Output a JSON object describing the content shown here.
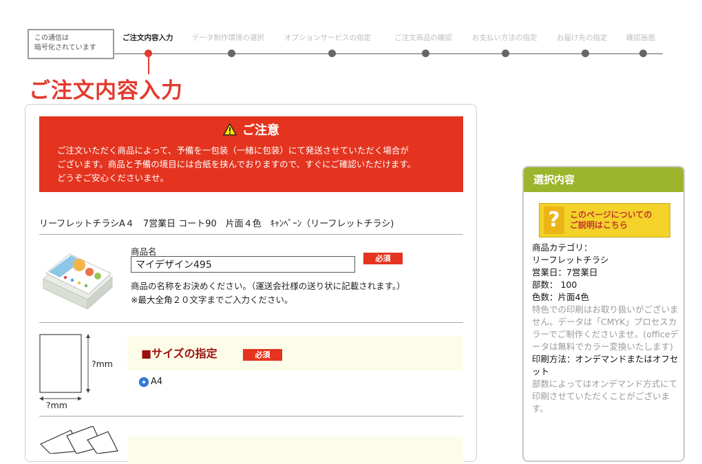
{
  "header": {
    "secure_notice": [
      "この通信は",
      "暗号化されています"
    ],
    "steps": [
      "ご注文内容入力",
      "データ制作環境の選択",
      "オプションサービスの指定",
      "ご注文商品の確認",
      "お支払い方法の指定",
      "お届け先の指定",
      "確認画面"
    ],
    "active_step": 0,
    "accent_color": "#e23a2d"
  },
  "page": {
    "title": "ご注文内容入力"
  },
  "notice": {
    "title": "ご注意",
    "lines": [
      "ご注文いただく商品によって、予備を一包装（一緒に包装）にて発送させていただく場合が",
      "ございます。商品と予備の境目には合紙を挟んでおりますので、すぐにご確認いただけます。",
      "どうぞご安心くださいませ。"
    ],
    "icon": "warning-icon",
    "color": "#e4341f"
  },
  "order": {
    "product_summary": "リーフレットチラシA４　7営業日 コート90　片面４色　ｷｬﾝﾍﾟｰﾝ（リーフレットチラシ)",
    "name_field": {
      "label": "商品名",
      "value": "マイデザイン495",
      "required_label": "必須",
      "help": [
        "商品の名称をお決めください。（運送会社様の送り状に記載されます。）",
        "※最大全角２０文字までご入力ください。"
      ]
    },
    "size": {
      "title": "■サイズの指定",
      "required_label": "必須",
      "dim_label": "?mm",
      "selected_option": "A4"
    }
  },
  "sidebar": {
    "title": "選択内容",
    "help_button": [
      "このページについての",
      "ご説明はこちら"
    ],
    "help_icon": "question-icon",
    "info": [
      {
        "text": "商品カテゴリ：",
        "muted": false
      },
      {
        "text": "リーフレットチラシ",
        "muted": false
      },
      {
        "text": "営業日：7営業日",
        "muted": false
      },
      {
        "text": "部数： 100",
        "muted": false
      },
      {
        "text": "色数：片面4色",
        "muted": false
      },
      {
        "text": "特色での印刷はお取り扱いがございません。データは「CMYK」プロセスカラーでご制作くださいませ。(officeデータは無料でカラー変換いたします)",
        "muted": true
      },
      {
        "text": "印刷方法：オンデマンドまたはオフセット",
        "muted": false
      },
      {
        "text": "部数によってはオンデマンド方式にて印刷させていただくことがございます。",
        "muted": true
      }
    ],
    "header_color": "#9cb52d"
  }
}
